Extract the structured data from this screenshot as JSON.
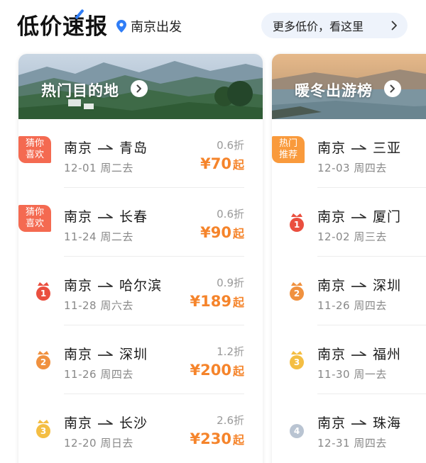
{
  "header": {
    "title": "低价速报",
    "location": "南京出发",
    "more_label": "更多低价，看这里"
  },
  "cards": [
    {
      "title": "热门目的地",
      "rows": [
        {
          "from": "南京",
          "to": "青岛",
          "date": "12-01 周二去",
          "discount": "0.6折",
          "price": "¥70",
          "suffix": "起",
          "tag": "猜你喜欢"
        },
        {
          "from": "南京",
          "to": "长春",
          "date": "11-24 周二去",
          "discount": "0.6折",
          "price": "¥90",
          "suffix": "起",
          "tag": "猜你喜欢"
        },
        {
          "from": "南京",
          "to": "哈尔滨",
          "date": "11-28 周六去",
          "discount": "0.9折",
          "price": "¥189",
          "suffix": "起",
          "rank": "1"
        },
        {
          "from": "南京",
          "to": "深圳",
          "date": "11-26 周四去",
          "discount": "1.2折",
          "price": "¥200",
          "suffix": "起",
          "rank": "2"
        },
        {
          "from": "南京",
          "to": "长沙",
          "date": "12-20 周日去",
          "discount": "2.6折",
          "price": "¥230",
          "suffix": "起",
          "rank": "3"
        }
      ]
    },
    {
      "title": "暖冬出游榜",
      "rows": [
        {
          "from": "南京",
          "to": "三亚",
          "date": "12-03 周四去",
          "tag": "热门推荐"
        },
        {
          "from": "南京",
          "to": "厦门",
          "date": "12-02 周三去",
          "rank": "1"
        },
        {
          "from": "南京",
          "to": "深圳",
          "date": "11-26 周四去",
          "rank": "2"
        },
        {
          "from": "南京",
          "to": "福州",
          "date": "11-30 周一去",
          "rank": "3"
        },
        {
          "from": "南京",
          "to": "珠海",
          "date": "12-31 周四去",
          "rank": "4"
        }
      ]
    }
  ],
  "colors": {
    "accent_price": "#f5842b",
    "tag_red": "#f46a51",
    "tag_orange": "#f99a3c",
    "rank1": "#ea4f3f",
    "rank2": "#f0913f",
    "rank3": "#f4be43",
    "rank4": "#b9c4d2",
    "link_bg": "#eef3fb",
    "brand_blue": "#2f7df6"
  },
  "icons": [
    "location-pin-icon",
    "chevron-right-icon",
    "route-arrow-icon",
    "crown-rank-icon",
    "rank-circle-icon"
  ]
}
